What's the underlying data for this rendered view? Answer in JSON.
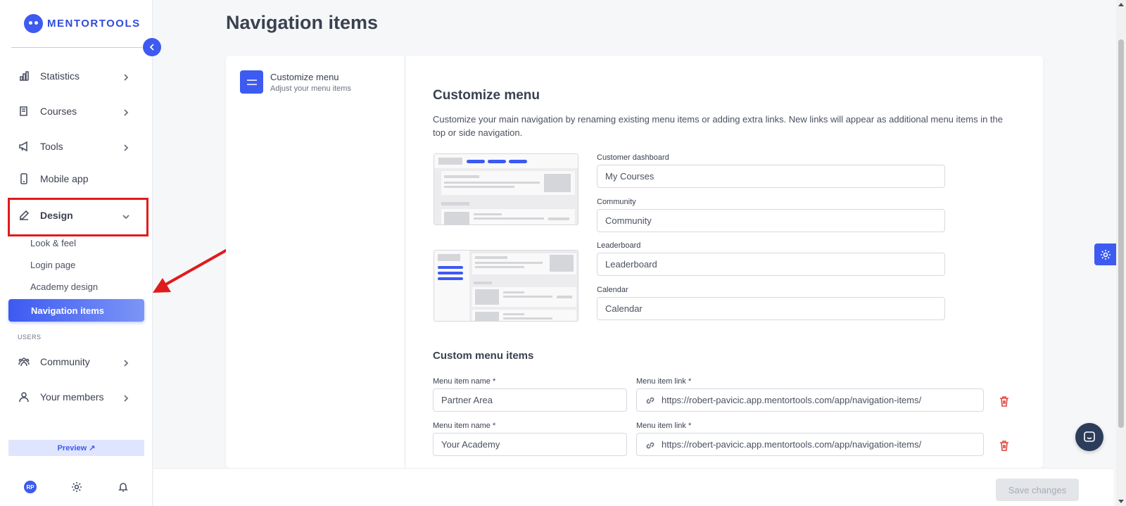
{
  "brand": {
    "name": "MENTORTOOLS"
  },
  "sidebar": {
    "items": [
      {
        "label": "Statistics",
        "icon": "bar-chart-icon"
      },
      {
        "label": "Courses",
        "icon": "book-icon"
      },
      {
        "label": "Tools",
        "icon": "megaphone-icon"
      },
      {
        "label": "Mobile app",
        "icon": "smartphone-icon"
      },
      {
        "label": "Design",
        "icon": "pencil-icon"
      }
    ],
    "design_subitems": [
      "Look & feel",
      "Login page",
      "Academy design",
      "Navigation items"
    ],
    "users_section_label": "USERS",
    "user_items": [
      {
        "label": "Community",
        "icon": "users-icon"
      },
      {
        "label": "Your members",
        "icon": "user-icon"
      }
    ],
    "preview_label": "Preview ↗",
    "avatar_initials": "RP"
  },
  "page": {
    "title": "Navigation items"
  },
  "tab": {
    "title": "Customize menu",
    "subtitle": "Adjust your menu items"
  },
  "customize": {
    "heading": "Customize menu",
    "description": "Customize your main navigation by renaming existing menu items or adding extra links. New links will appear as additional menu items in the top or side navigation.",
    "fields": [
      {
        "label": "Customer dashboard",
        "value": "My Courses"
      },
      {
        "label": "Community",
        "value": "Community"
      },
      {
        "label": "Leaderboard",
        "value": "Leaderboard"
      },
      {
        "label": "Calendar",
        "value": "Calendar"
      }
    ]
  },
  "custom_items": {
    "heading": "Custom menu items",
    "name_label": "Menu item name *",
    "link_label": "Menu item link *",
    "rows": [
      {
        "name": "Partner Area",
        "link": "https://robert-pavicic.app.mentortools.com/app/navigation-items/"
      },
      {
        "name": "Your Academy",
        "link": "https://robert-pavicic.app.mentortools.com/app/navigation-items/"
      }
    ]
  },
  "footer": {
    "save_label": "Save changes"
  },
  "colors": {
    "accent": "#3d5af1",
    "highlight": "#e01b1b",
    "delete": "#e0443c"
  }
}
